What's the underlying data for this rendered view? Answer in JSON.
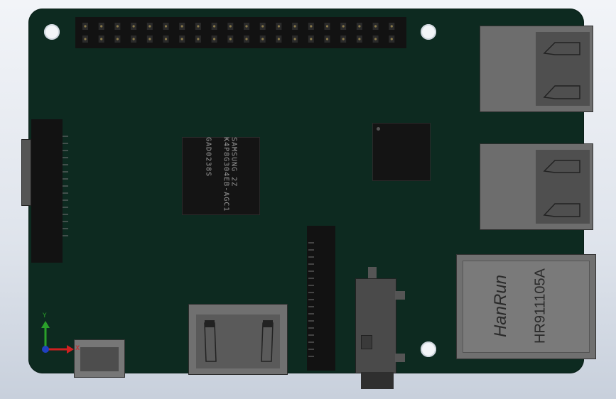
{
  "viewer": {
    "title": "",
    "axis_triad": {
      "y_label": "Y",
      "x_label": "X"
    }
  },
  "board": {
    "ram_chip": {
      "line1": "SAMSUNG   2Z",
      "line2": "K4P8G304EB-AGC1",
      "line3": "GAD0238S"
    },
    "soc_chip": {
      "marking": ""
    },
    "ethernet": {
      "brand": "HanRun",
      "part": "HR911105A"
    },
    "components": [
      "gpio-header",
      "ram-chip",
      "soc-chip",
      "usb-port-top",
      "usb-port-bottom",
      "ethernet-jack",
      "camera-connector",
      "display-connector",
      "hdmi-port",
      "audio-jack",
      "micro-usb-port"
    ],
    "colors": {
      "pcb": "#0d2a20",
      "connector": "#6d6d6d",
      "chip": "#141414",
      "background": "#e6eaf0"
    }
  }
}
